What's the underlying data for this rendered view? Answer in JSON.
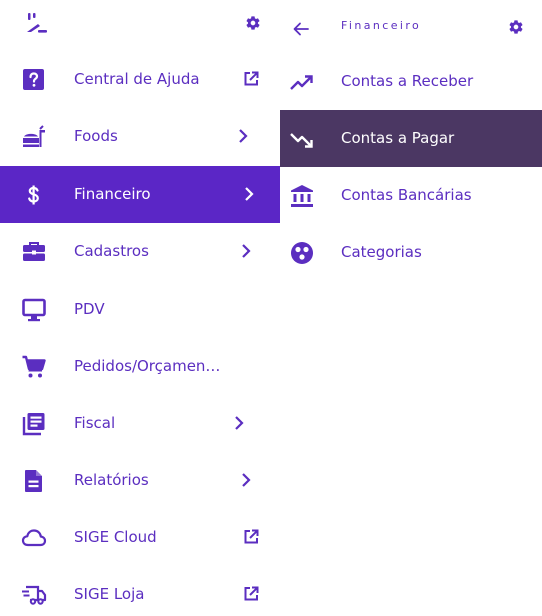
{
  "colors": {
    "accent": "#5b26c6",
    "text": "#5b2ec0",
    "active_submenu_bg": "#4b3763",
    "active_text": "#ffffff"
  },
  "sidebar": {
    "items": [
      {
        "label": "Central de Ajuda",
        "icon": "help-icon",
        "right": "external-link-icon"
      },
      {
        "label": "Foods",
        "icon": "foods-icon",
        "right": "chevron-right-icon"
      },
      {
        "label": "Financeiro",
        "icon": "dollar-icon",
        "right": "chevron-right-icon",
        "active": true
      },
      {
        "label": "Cadastros",
        "icon": "briefcase-icon",
        "right": "chevron-right-icon"
      },
      {
        "label": "PDV",
        "icon": "monitor-icon",
        "right": ""
      },
      {
        "label": "Pedidos/Orçamen…",
        "icon": "cart-icon",
        "right": ""
      },
      {
        "label": "Fiscal",
        "icon": "fiscal-icon",
        "right": "chevron-right-icon"
      },
      {
        "label": "Relatórios",
        "icon": "document-icon",
        "right": "chevron-right-icon"
      },
      {
        "label": "SIGE Cloud",
        "icon": "cloud-icon",
        "right": "external-link-icon"
      },
      {
        "label": "SIGE Loja",
        "icon": "delivery-truck-icon",
        "right": "external-link-icon"
      }
    ]
  },
  "submenu": {
    "title": "Financeiro",
    "items": [
      {
        "label": "Contas a Receber",
        "icon": "trending-up-icon"
      },
      {
        "label": "Contas a Pagar",
        "icon": "trending-down-icon",
        "active": true
      },
      {
        "label": "Contas Bancárias",
        "icon": "bank-icon"
      },
      {
        "label": "Categorias",
        "icon": "categories-icon"
      }
    ]
  }
}
